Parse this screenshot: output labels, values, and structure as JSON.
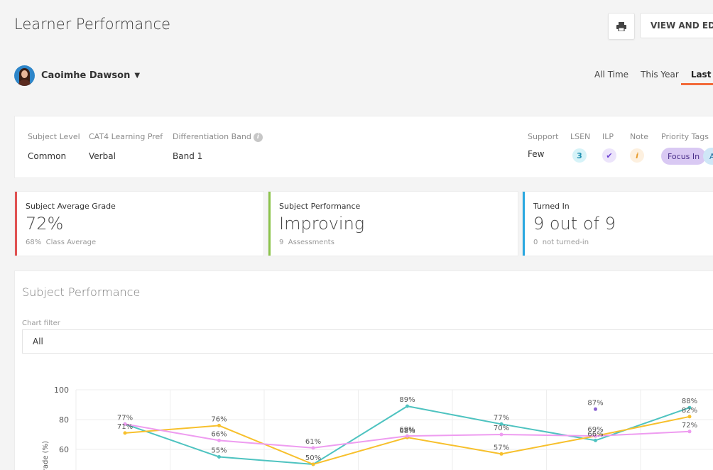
{
  "header": {
    "title": "Learner Performance",
    "edit_label": "VIEW AND EDIT",
    "print_icon": "print-icon"
  },
  "learner": {
    "name": "Caoimhe Dawson"
  },
  "range_tabs": [
    "All Time",
    "This Year",
    "Last Year"
  ],
  "info": {
    "subject_level_label": "Subject Level",
    "subject_level": "Common",
    "cat4_label": "CAT4 Learning Pref",
    "cat4": "Verbal",
    "diff_band_label": "Differentiation Band",
    "diff_band": "Band 1",
    "support_label": "Support",
    "support": "Few",
    "lsen_label": "LSEN",
    "lsen": "3",
    "ilp_label": "ILP",
    "note_label": "Note",
    "priority_label": "Priority Tags",
    "priority_tags": [
      "Focus In",
      "A"
    ]
  },
  "stats": [
    {
      "title": "Subject Average Grade",
      "value": "72%",
      "sub_value": "68%",
      "sub_label": "Class Average",
      "color": "#e05252"
    },
    {
      "title": "Subject Performance",
      "value": "Improving",
      "sub_value": "9",
      "sub_label": "Assessments",
      "color": "#8bc34a"
    },
    {
      "title": "Turned In",
      "value": "9 out of 9",
      "sub_value": "0",
      "sub_label": "not turned-in",
      "color": "#29a8e0"
    }
  ],
  "performance": {
    "title": "Subject Performance",
    "filter_label": "Chart filter",
    "filter_value": "All"
  },
  "chart_data": {
    "type": "line",
    "ylabel": "Grade (%)",
    "ylim": [
      40,
      100
    ],
    "yticks": [
      60,
      80,
      100
    ],
    "x": [
      1,
      2,
      3,
      4,
      5,
      6,
      7
    ],
    "series": [
      {
        "color": "#4ec3c0",
        "values": [
          77,
          55,
          50,
          89,
          77,
          66,
          88
        ]
      },
      {
        "color": "#f7c02c",
        "values": [
          71,
          76,
          50,
          68,
          57,
          69,
          82
        ]
      },
      {
        "color": "#ee9cf0",
        "values": [
          77,
          66,
          61,
          69,
          70,
          69,
          72
        ]
      },
      {
        "color": "#8a63d2",
        "values": [
          null,
          null,
          null,
          null,
          null,
          87,
          null
        ]
      }
    ],
    "data_labels": [
      {
        "x": 1,
        "text": "77%",
        "v": 77
      },
      {
        "x": 1,
        "text": "71%",
        "v": 71
      },
      {
        "x": 2,
        "text": "76%",
        "v": 76
      },
      {
        "x": 2,
        "text": "66%",
        "v": 66
      },
      {
        "x": 2,
        "text": "55%",
        "v": 55
      },
      {
        "x": 3,
        "text": "61%",
        "v": 61
      },
      {
        "x": 3,
        "text": "50%",
        "v": 50
      },
      {
        "x": 4,
        "text": "89%",
        "v": 89
      },
      {
        "x": 4,
        "text": "69%",
        "v": 69
      },
      {
        "x": 4,
        "text": "68%",
        "v": 68
      },
      {
        "x": 5,
        "text": "77%",
        "v": 77
      },
      {
        "x": 5,
        "text": "70%",
        "v": 70
      },
      {
        "x": 5,
        "text": "57%",
        "v": 57
      },
      {
        "x": 6,
        "text": "87%",
        "v": 87
      },
      {
        "x": 6,
        "text": "69%",
        "v": 69
      },
      {
        "x": 6,
        "text": "66%",
        "v": 66
      },
      {
        "x": 7,
        "text": "88%",
        "v": 88
      },
      {
        "x": 7,
        "text": "82%",
        "v": 82
      },
      {
        "x": 7,
        "text": "72%",
        "v": 72
      }
    ]
  }
}
